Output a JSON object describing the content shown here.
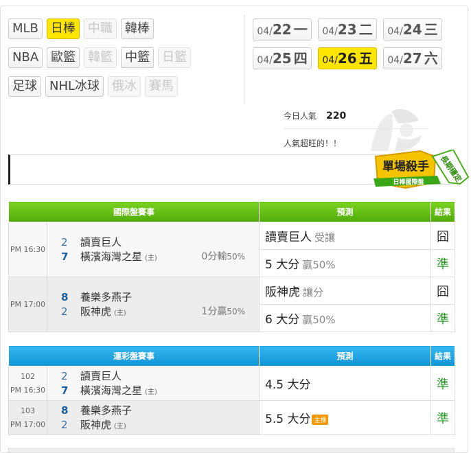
{
  "sports": [
    [
      {
        "label": "MLB",
        "state": "normal"
      },
      {
        "label": "日棒",
        "state": "active"
      },
      {
        "label": "中職",
        "state": "disabled"
      },
      {
        "label": "韓棒",
        "state": "normal"
      }
    ],
    [
      {
        "label": "NBA",
        "state": "normal"
      },
      {
        "label": "歐籃",
        "state": "normal"
      },
      {
        "label": "韓籃",
        "state": "disabled"
      },
      {
        "label": "中籃",
        "state": "normal"
      },
      {
        "label": "日籃",
        "state": "disabled"
      }
    ],
    [
      {
        "label": "足球",
        "state": "normal"
      },
      {
        "label": "NHL冰球",
        "state": "normal"
      },
      {
        "label": "俄冰",
        "state": "disabled"
      },
      {
        "label": "賽馬",
        "state": "disabled"
      }
    ]
  ],
  "dates": [
    [
      {
        "md": "04/",
        "d": "22",
        "wd": "一",
        "active": false
      },
      {
        "md": "04/",
        "d": "23",
        "wd": "二",
        "active": false
      },
      {
        "md": "04/",
        "d": "24",
        "wd": "三",
        "active": false
      }
    ],
    [
      {
        "md": "04/",
        "d": "25",
        "wd": "四",
        "active": false
      },
      {
        "md": "04/",
        "d": "26",
        "wd": "五",
        "active": true
      },
      {
        "md": "04/",
        "d": "27",
        "wd": "六",
        "active": false
      }
    ]
  ],
  "popularity": {
    "label": "今日人氣",
    "value": "220",
    "note": "人氣超旺的！！"
  },
  "badge": {
    "title": "單場殺手",
    "subtitle": "日棒國際盤",
    "ribbon": "長期穩定"
  },
  "intl": {
    "headers": [
      "國際盤賽事",
      "預測",
      "結果"
    ],
    "games": [
      {
        "time": "PM 16:30",
        "away_score": "2",
        "away": "讀賣巨人",
        "home_score": "7",
        "home": "橫濱海灣之星",
        "home_mark": "(主)",
        "odds": "0分輸",
        "odds_pct": "50%",
        "preds": [
          {
            "main": "讀賣巨人",
            "sub": "受讓",
            "result": "囧",
            "win": false
          },
          {
            "main": "5 大分",
            "sub": "贏50%",
            "result": "準",
            "win": true
          }
        ]
      },
      {
        "time": "PM 17:00",
        "away_score": "8",
        "away": "養樂多燕子",
        "home_score": "2",
        "home": "阪神虎",
        "home_mark": "(主)",
        "odds": "1分贏",
        "odds_pct": "50%",
        "preds": [
          {
            "main": "阪神虎",
            "sub": "讓分",
            "result": "囧",
            "win": false
          },
          {
            "main": "6 大分",
            "sub": "贏50%",
            "result": "準",
            "win": true
          }
        ]
      }
    ]
  },
  "lottery": {
    "headers": [
      "運彩盤賽事",
      "預測",
      "結果"
    ],
    "games": [
      {
        "no": "102",
        "time": "PM 16:30",
        "away_score": "2",
        "away": "讀賣巨人",
        "home_score": "7",
        "home": "橫濱海灣之星",
        "home_mark": "(主)",
        "pred": "4.5 大分",
        "tag": "",
        "result": "準"
      },
      {
        "no": "103",
        "time": "PM 17:00",
        "away_score": "8",
        "away": "養樂多燕子",
        "home_score": "2",
        "home": "阪神虎",
        "home_mark": "(主)",
        "pred": "5.5 大分",
        "tag": "主推",
        "result": "準"
      }
    ]
  }
}
